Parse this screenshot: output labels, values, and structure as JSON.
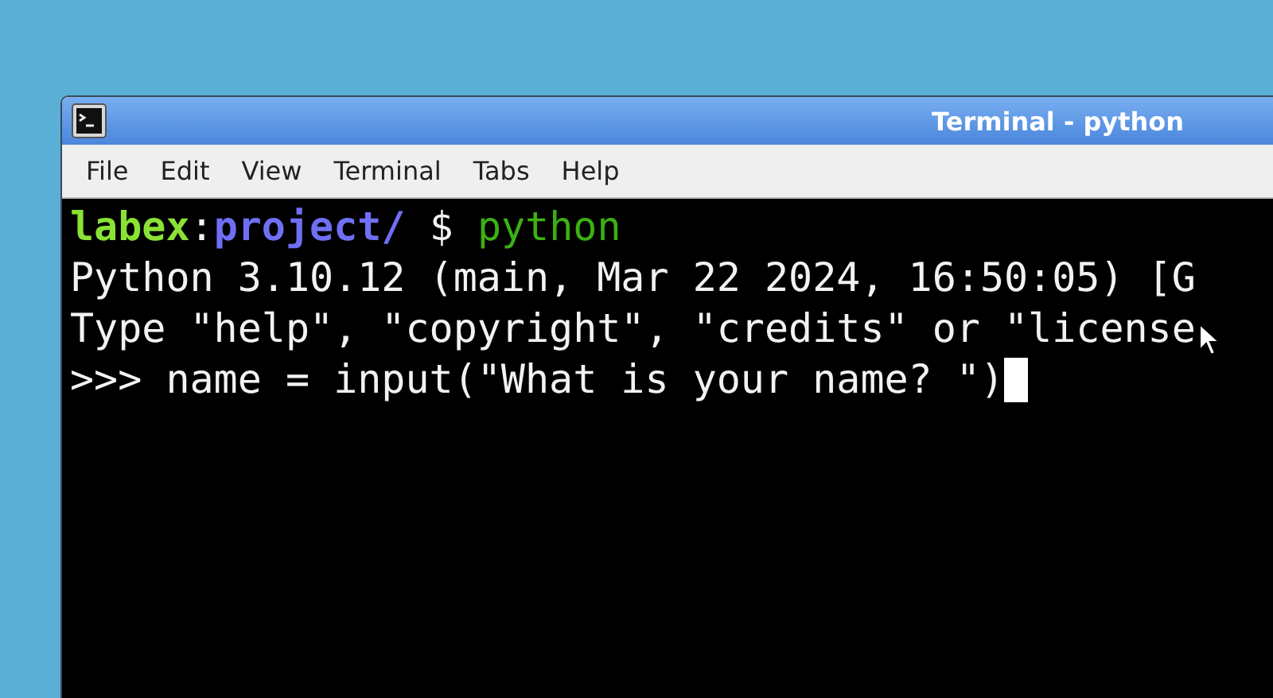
{
  "window": {
    "title": "Terminal - python"
  },
  "menu": [
    "File",
    "Edit",
    "View",
    "Terminal",
    "Tabs",
    "Help"
  ],
  "terminal": {
    "prompt": {
      "user": "labex",
      "separator": ":",
      "path": "project/",
      "symbol": "$",
      "command": "python"
    },
    "lines": [
      "Python 3.10.12 (main, Mar 22 2024, 16:50:05) [G",
      "Type \"help\", \"copyright\", \"credits\" or \"license"
    ],
    "input_line": ">>> name = input(\"What is your name? \")",
    "cursor": true
  }
}
